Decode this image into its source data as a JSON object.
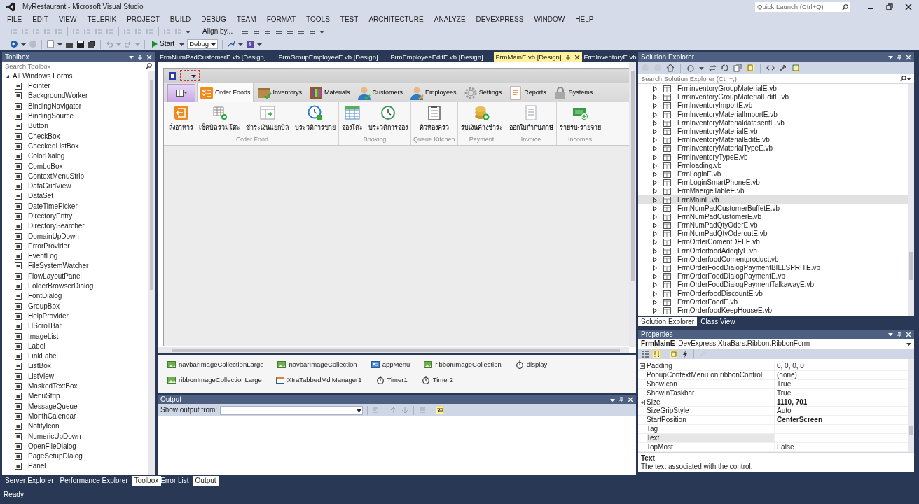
{
  "window": {
    "title": "MyRestaurant - Microsoft Visual Studio",
    "quick_launch": {
      "placeholder": "Quick Launch (Ctrl+Q)"
    }
  },
  "menu": [
    "FILE",
    "EDIT",
    "VIEW",
    "TELERIK",
    "PROJECT",
    "BUILD",
    "DEBUG",
    "TEAM",
    "FORMAT",
    "TOOLS",
    "TEST",
    "ARCHITECTURE",
    "ANALYZE",
    "DEVEXPRESS",
    "WINDOW",
    "HELP"
  ],
  "toolbar": {
    "align_label": "Align by...",
    "start_label": "Start",
    "configuration": "Debug"
  },
  "toolbox": {
    "title": "Toolbox",
    "search": {
      "placeholder": "Search Toolbox"
    },
    "group": {
      "label": "All Windows Forms",
      "expanded": true
    },
    "items": [
      "Pointer",
      "BackgroundWorker",
      "BindingNavigator",
      "BindingSource",
      "Button",
      "CheckBox",
      "CheckedListBox",
      "ColorDialog",
      "ComboBox",
      "ContextMenuStrip",
      "DataGridView",
      "DataSet",
      "DateTimePicker",
      "DirectoryEntry",
      "DirectorySearcher",
      "DomainUpDown",
      "ErrorProvider",
      "EventLog",
      "FileSystemWatcher",
      "FlowLayoutPanel",
      "FolderBrowserDialog",
      "FontDialog",
      "GroupBox",
      "HelpProvider",
      "HScrollBar",
      "ImageList",
      "Label",
      "LinkLabel",
      "ListBox",
      "ListView",
      "MaskedTextBox",
      "MenuStrip",
      "MessageQueue",
      "MonthCalendar",
      "NotifyIcon",
      "NumericUpDown",
      "OpenFileDialog",
      "PageSetupDialog",
      "Panel"
    ],
    "tabs": [
      {
        "label": "Server Explorer",
        "selected": false
      },
      {
        "label": "Performance Explorer",
        "selected": false
      },
      {
        "label": "Toolbox",
        "selected": true
      }
    ]
  },
  "documents": {
    "tabs": [
      {
        "label": "FrmNumPadCustomerE.vb [Design]",
        "selected": false
      },
      {
        "label": "FrmGroupEmployeeE.vb [Design]",
        "selected": false
      },
      {
        "label": "FrmEmployeeEditE.vb [Design]",
        "selected": false
      },
      {
        "label": "FrmMainE.vb [Design]",
        "selected": true
      },
      {
        "label": "FrmInventoryE.vb",
        "selected": false
      }
    ]
  },
  "designer": {
    "ribbon_tabs": [
      {
        "label": "Order Foods",
        "selected": true
      },
      {
        "label": "Inventorys",
        "selected": false
      },
      {
        "label": "Materials",
        "selected": false
      },
      {
        "label": "Customers",
        "selected": false
      },
      {
        "label": "Employees",
        "selected": false
      },
      {
        "label": "Settings",
        "selected": false
      },
      {
        "label": "Reports",
        "selected": false
      },
      {
        "label": "Systems",
        "selected": false
      }
    ],
    "groups": [
      {
        "caption": "Order Food",
        "items": [
          "สั่งอาหาร",
          "เช็คบิลรวมโต๊ะ",
          "ชำระเงินแยกบิล",
          "ประวัติการขาย"
        ]
      },
      {
        "caption": "Booking",
        "items": [
          "จองโต๊ะ",
          "ประวัติการจอง"
        ]
      },
      {
        "caption": "Queue Kitchen",
        "items": [
          "คิวห้องครัว"
        ]
      },
      {
        "caption": "Payment",
        "items": [
          "รับเงินค้างชำระ"
        ]
      },
      {
        "caption": "Invoice",
        "items": [
          "ออกใบกำกับภาษี"
        ]
      },
      {
        "caption": "Incomes",
        "items": [
          "รายรับ-รายจ่าย"
        ]
      }
    ],
    "components": [
      {
        "label": "navbarImageCollectionLarge",
        "kind": "image_collection"
      },
      {
        "label": "navbarImageCollection",
        "kind": "image_collection"
      },
      {
        "label": "appMenu",
        "kind": "menu"
      },
      {
        "label": "ribbonImageCollection",
        "kind": "image_collection"
      },
      {
        "label": "display",
        "kind": "timer"
      },
      {
        "label": "ribbonImageCollectionLarge",
        "kind": "image_collection"
      },
      {
        "label": "XtraTabbedMdiManager1",
        "kind": "mdi_manager"
      },
      {
        "label": "Timer1",
        "kind": "timer"
      },
      {
        "label": "Timer2",
        "kind": "timer"
      }
    ]
  },
  "output": {
    "title": "Output",
    "source_label": "Show output from:",
    "tabs": [
      {
        "label": "Error List",
        "selected": false
      },
      {
        "label": "Output",
        "selected": true
      }
    ]
  },
  "solution_explorer": {
    "title": "Solution Explorer",
    "search": {
      "placeholder": "Search Solution Explorer (Ctrl+;)"
    },
    "items": [
      {
        "label": "FrminventoryGroupMaterialE.vb",
        "selected": false,
        "expanded": false
      },
      {
        "label": "FrminventoryGroupMaterialEditE.vb",
        "selected": false,
        "expanded": false
      },
      {
        "label": "FrmInventoryImportE.vb",
        "selected": false,
        "expanded": false
      },
      {
        "label": "FrmInventoryMaterialImportE.vb",
        "selected": false,
        "expanded": false
      },
      {
        "label": "FrmInventoryMaterialdatasentE.vb",
        "selected": false,
        "expanded": false
      },
      {
        "label": "FrmInventoryMaterialE.vb",
        "selected": false,
        "expanded": false
      },
      {
        "label": "FrmInventoryMaterialEditE.vb",
        "selected": false,
        "expanded": false
      },
      {
        "label": "FrmInventoryMaterialTypeE.vb",
        "selected": false,
        "expanded": false
      },
      {
        "label": "FrmInventoryTypeE.vb",
        "selected": false,
        "expanded": false
      },
      {
        "label": "Frmloading.vb",
        "selected": false,
        "expanded": false
      },
      {
        "label": "FrmLoginE.vb",
        "selected": false,
        "expanded": false
      },
      {
        "label": "FrmLoginSmartPhoneE.vb",
        "selected": false,
        "expanded": false
      },
      {
        "label": "FrmMaergeTableE.vb",
        "selected": false,
        "expanded": false
      },
      {
        "label": "FrmMainE.vb",
        "selected": true,
        "expanded": false
      },
      {
        "label": "FrmNumPadCustomerBuffetE.vb",
        "selected": false,
        "expanded": false
      },
      {
        "label": "FrmNumPadCustomerE.vb",
        "selected": false,
        "expanded": false
      },
      {
        "label": "FrmNumPadQtyOderE.vb",
        "selected": false,
        "expanded": false
      },
      {
        "label": "FrmNumPadQtyOderoutE.vb",
        "selected": false,
        "expanded": false
      },
      {
        "label": "FrmOrderComentDELE.vb",
        "selected": false,
        "expanded": false
      },
      {
        "label": "FrmOrderfoodAddqtyE.vb",
        "selected": false,
        "expanded": false
      },
      {
        "label": "FrmOrderfoodComentproduct.vb",
        "selected": false,
        "expanded": false
      },
      {
        "label": "FrmOrderFoodDialogPaymentBILLSPRITE.vb",
        "selected": false,
        "expanded": false
      },
      {
        "label": "FrmOrderFoodDialogPaymentE.vb",
        "selected": false,
        "expanded": false
      },
      {
        "label": "FrmOrderFoodDialogPaymentTalkawayE.vb",
        "selected": false,
        "expanded": false
      },
      {
        "label": "FrmOrderfoodDiscountE.vb",
        "selected": false,
        "expanded": false
      },
      {
        "label": "FrmOrderFoodE.vb",
        "selected": false,
        "expanded": false
      },
      {
        "label": "FrmOrderfoodKeepHouseE.vb",
        "selected": false,
        "expanded": false
      }
    ],
    "tabs": [
      {
        "label": "Solution Explorer",
        "selected": true
      },
      {
        "label": "Class View",
        "selected": false
      }
    ]
  },
  "properties": {
    "title": "Properties",
    "object_name": "FrmMainE",
    "object_type": "DevExpress.XtraBars.Ribbon.RibbonForm",
    "rows": [
      {
        "name": "Padding",
        "value": "0, 0, 0, 0",
        "expandable": true,
        "modified": false,
        "selected": false
      },
      {
        "name": "PopupContextMenu on ribbonControl",
        "value": "(none)",
        "expandable": false,
        "modified": false,
        "selected": false
      },
      {
        "name": "ShowIcon",
        "value": "True",
        "expandable": false,
        "modified": false,
        "selected": false
      },
      {
        "name": "ShowInTaskbar",
        "value": "True",
        "expandable": false,
        "modified": false,
        "selected": false
      },
      {
        "name": "Size",
        "value": "1110, 701",
        "expandable": true,
        "modified": true,
        "selected": false
      },
      {
        "name": "SizeGripStyle",
        "value": "Auto",
        "expandable": false,
        "modified": false,
        "selected": false
      },
      {
        "name": "StartPosition",
        "value": "CenterScreen",
        "expandable": false,
        "modified": true,
        "selected": false
      },
      {
        "name": "Tag",
        "expandable": false,
        "selected": false
      },
      {
        "name": "Text",
        "expandable": false,
        "selected": true
      },
      {
        "name": "TopMost",
        "value": "False",
        "expandable": false,
        "modified": false,
        "selected": false
      }
    ],
    "description": {
      "title": "Text",
      "text": "The text associated with the control."
    }
  },
  "status_bar": "Ready"
}
